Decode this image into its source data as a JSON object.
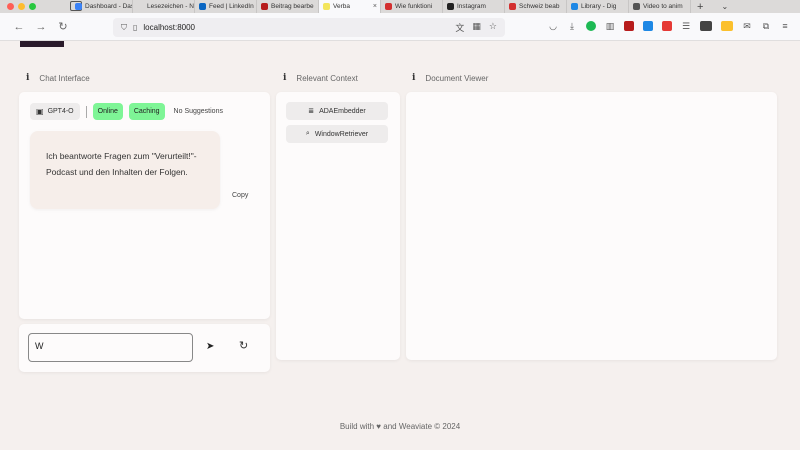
{
  "browser": {
    "tabs": [
      {
        "label": "Dashboard - Dash",
        "fav": "#3b82f6",
        "active": false
      },
      {
        "label": "Lesezeichen - N",
        "fav": "#dcdad9",
        "active": false
      },
      {
        "label": "Feed | LinkedIn",
        "fav": "#0a66c2",
        "active": false
      },
      {
        "label": "Beitrag bearbe",
        "fav": "#b71c1c",
        "active": false
      },
      {
        "label": "Verba",
        "fav": "#f3e55c",
        "active": true
      },
      {
        "label": "Wie funktioni",
        "fav": "#d32f2f",
        "active": false
      },
      {
        "label": "Instagram",
        "fav": "#222222",
        "active": false
      },
      {
        "label": "Schweiz beab",
        "fav": "#d32f2f",
        "active": false
      },
      {
        "label": "Library - Dig",
        "fav": "#1e88e5",
        "active": false
      },
      {
        "label": "Video to anim",
        "fav": "#555555",
        "active": false
      }
    ],
    "url": "localhost:8000"
  },
  "sections": {
    "chat": "Chat Interface",
    "context": "Relevant Context",
    "viewer": "Document Viewer"
  },
  "chat": {
    "model": "GPT4-O",
    "status_online": "Online",
    "status_caching": "Caching",
    "suggestions": "No Suggestions",
    "message": "Ich beantworte Fragen zum \"Verurteilt!\"-Podcast und den Inhalten der Folgen.",
    "copy_label": "Copy",
    "input_value": "W"
  },
  "context": {
    "buttons": [
      "ADAEmbedder",
      "WindowRetriever"
    ]
  },
  "footer": "Build with ♥ and Weaviate © 2024",
  "colors": {
    "background": "#f5f0ee",
    "panel": "#fdfbfb",
    "badge_green": "#7ef596",
    "bubble": "#f6eeea"
  }
}
